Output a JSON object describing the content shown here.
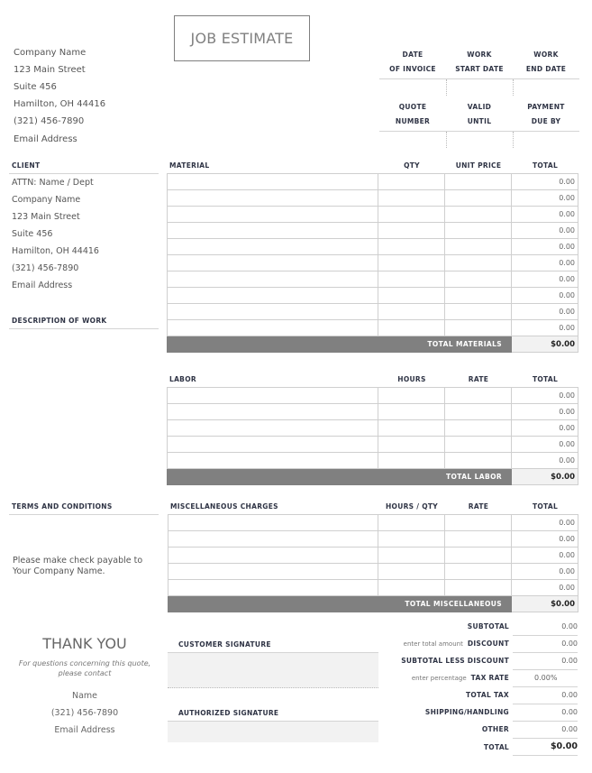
{
  "title": "JOB ESTIMATE",
  "company": {
    "name": "Company Name",
    "street": "123 Main Street",
    "suite": "Suite 456",
    "city": "Hamilton, OH  44416",
    "phone": "(321) 456-7890",
    "email": "Email Address"
  },
  "header_fields": {
    "row1": [
      {
        "line1": "DATE",
        "line2": "OF INVOICE",
        "value": ""
      },
      {
        "line1": "WORK",
        "line2": "START DATE",
        "value": ""
      },
      {
        "line1": "WORK",
        "line2": "END DATE",
        "value": ""
      }
    ],
    "row2": [
      {
        "line1": "QUOTE",
        "line2": "NUMBER",
        "value": ""
      },
      {
        "line1": "VALID",
        "line2": "UNTIL",
        "value": ""
      },
      {
        "line1": "PAYMENT",
        "line2": "DUE BY",
        "value": ""
      }
    ]
  },
  "client": {
    "heading": "CLIENT",
    "attn": "ATTN: Name / Dept",
    "company": "Company Name",
    "street": "123 Main Street",
    "suite": "Suite 456",
    "city": "Hamilton, OH  44416",
    "phone": "(321) 456-7890",
    "email": "Email Address"
  },
  "description": {
    "heading": "DESCRIPTION OF WORK",
    "text": ""
  },
  "materials": {
    "headers": [
      "MATERIAL",
      "QTY",
      "UNIT PRICE",
      "TOTAL"
    ],
    "rows": [
      {
        "item": "",
        "qty": "",
        "price": "",
        "total": "0.00"
      },
      {
        "item": "",
        "qty": "",
        "price": "",
        "total": "0.00"
      },
      {
        "item": "",
        "qty": "",
        "price": "",
        "total": "0.00"
      },
      {
        "item": "",
        "qty": "",
        "price": "",
        "total": "0.00"
      },
      {
        "item": "",
        "qty": "",
        "price": "",
        "total": "0.00"
      },
      {
        "item": "",
        "qty": "",
        "price": "",
        "total": "0.00"
      },
      {
        "item": "",
        "qty": "",
        "price": "",
        "total": "0.00"
      },
      {
        "item": "",
        "qty": "",
        "price": "",
        "total": "0.00"
      },
      {
        "item": "",
        "qty": "",
        "price": "",
        "total": "0.00"
      },
      {
        "item": "",
        "qty": "",
        "price": "",
        "total": "0.00"
      }
    ],
    "total_label": "TOTAL MATERIALS",
    "total_value": "$0.00"
  },
  "labor": {
    "headers": [
      "LABOR",
      "HOURS",
      "RATE",
      "TOTAL"
    ],
    "rows": [
      {
        "item": "",
        "hours": "",
        "rate": "",
        "total": "0.00"
      },
      {
        "item": "",
        "hours": "",
        "rate": "",
        "total": "0.00"
      },
      {
        "item": "",
        "hours": "",
        "rate": "",
        "total": "0.00"
      },
      {
        "item": "",
        "hours": "",
        "rate": "",
        "total": "0.00"
      },
      {
        "item": "",
        "hours": "",
        "rate": "",
        "total": "0.00"
      }
    ],
    "total_label": "TOTAL LABOR",
    "total_value": "$0.00"
  },
  "terms": {
    "heading": "TERMS AND CONDITIONS",
    "line1": "Please make check payable to",
    "line2": "Your Company Name."
  },
  "misc": {
    "headers": [
      "MISCELLANEOUS CHARGES",
      "HOURS / QTY",
      "RATE",
      "TOTAL"
    ],
    "rows": [
      {
        "item": "",
        "qty": "",
        "rate": "",
        "total": "0.00"
      },
      {
        "item": "",
        "qty": "",
        "rate": "",
        "total": "0.00"
      },
      {
        "item": "",
        "qty": "",
        "rate": "",
        "total": "0.00"
      },
      {
        "item": "",
        "qty": "",
        "rate": "",
        "total": "0.00"
      },
      {
        "item": "",
        "qty": "",
        "rate": "",
        "total": "0.00"
      }
    ],
    "total_label": "TOTAL MISCELLANEOUS",
    "total_value": "$0.00"
  },
  "summary": {
    "subtotal": {
      "label": "SUBTOTAL",
      "value": "0.00"
    },
    "discount": {
      "hint": "enter total amount",
      "label": "DISCOUNT",
      "value": "0.00"
    },
    "subtotal_less_discount": {
      "label": "SUBTOTAL LESS DISCOUNT",
      "value": "0.00"
    },
    "tax_rate": {
      "hint": "enter percentage",
      "label": "TAX RATE",
      "value": "0.00%"
    },
    "total_tax": {
      "label": "TOTAL TAX",
      "value": "0.00"
    },
    "shipping": {
      "label": "SHIPPING/HANDLING",
      "value": "0.00"
    },
    "other": {
      "label": "OTHER",
      "value": "0.00"
    },
    "total": {
      "label": "TOTAL",
      "value": "$0.00"
    }
  },
  "thank_you": {
    "heading": "THANK YOU",
    "note_line1": "For questions concerning this quote,",
    "note_line2": "please contact",
    "name": "Name",
    "phone": "(321) 456-7890",
    "email": "Email Address"
  },
  "signatures": {
    "customer": "CUSTOMER SIGNATURE",
    "authorized": "AUTHORIZED SIGNATURE"
  }
}
